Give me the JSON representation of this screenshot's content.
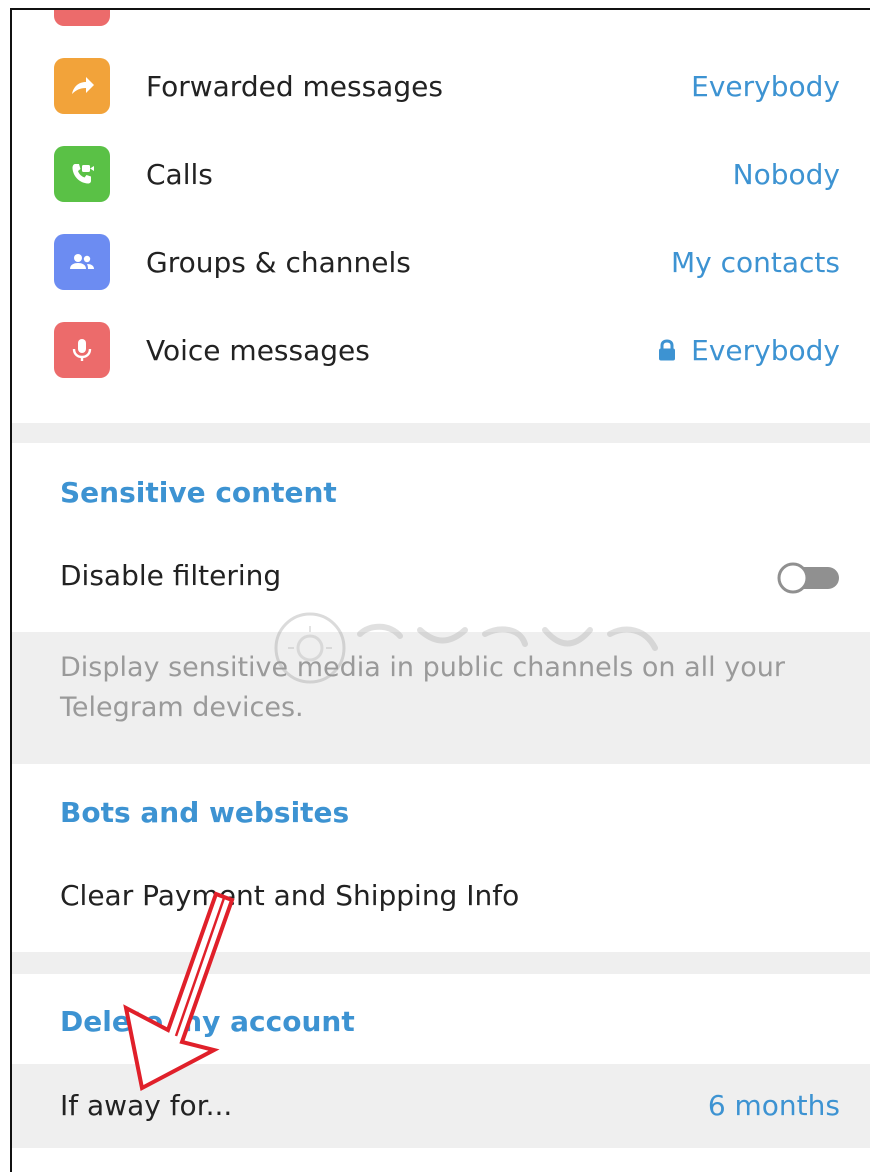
{
  "privacy_rows": [
    {
      "label": "Forwarded messages",
      "value": "Everybody",
      "icon": "forward-arrow-icon",
      "icon_color": "#f2a33a"
    },
    {
      "label": "Calls",
      "value": "Nobody",
      "icon": "phone-call-icon",
      "icon_color": "#5ac146"
    },
    {
      "label": "Groups & channels",
      "value": "My contacts",
      "icon": "group-people-icon",
      "icon_color": "#6c8cf2"
    },
    {
      "label": "Voice messages",
      "value": "Everybody",
      "icon": "microphone-icon",
      "icon_color": "#ec6b6b"
    }
  ],
  "sensitive": {
    "title": "Sensitive content",
    "toggle_label": "Disable filtering",
    "toggle_on": false,
    "description": "Display sensitive media in public channels on all your Telegram devices."
  },
  "bots": {
    "title": "Bots and websites",
    "clear_label": "Clear Payment and Shipping Info"
  },
  "delete_account": {
    "title": "Delete my account",
    "if_away_label": "If away for...",
    "if_away_value": "6 months"
  },
  "colors": {
    "accent": "#3d93d2",
    "section_bg": "#efefef",
    "annotation_arrow": "#e0202a"
  }
}
